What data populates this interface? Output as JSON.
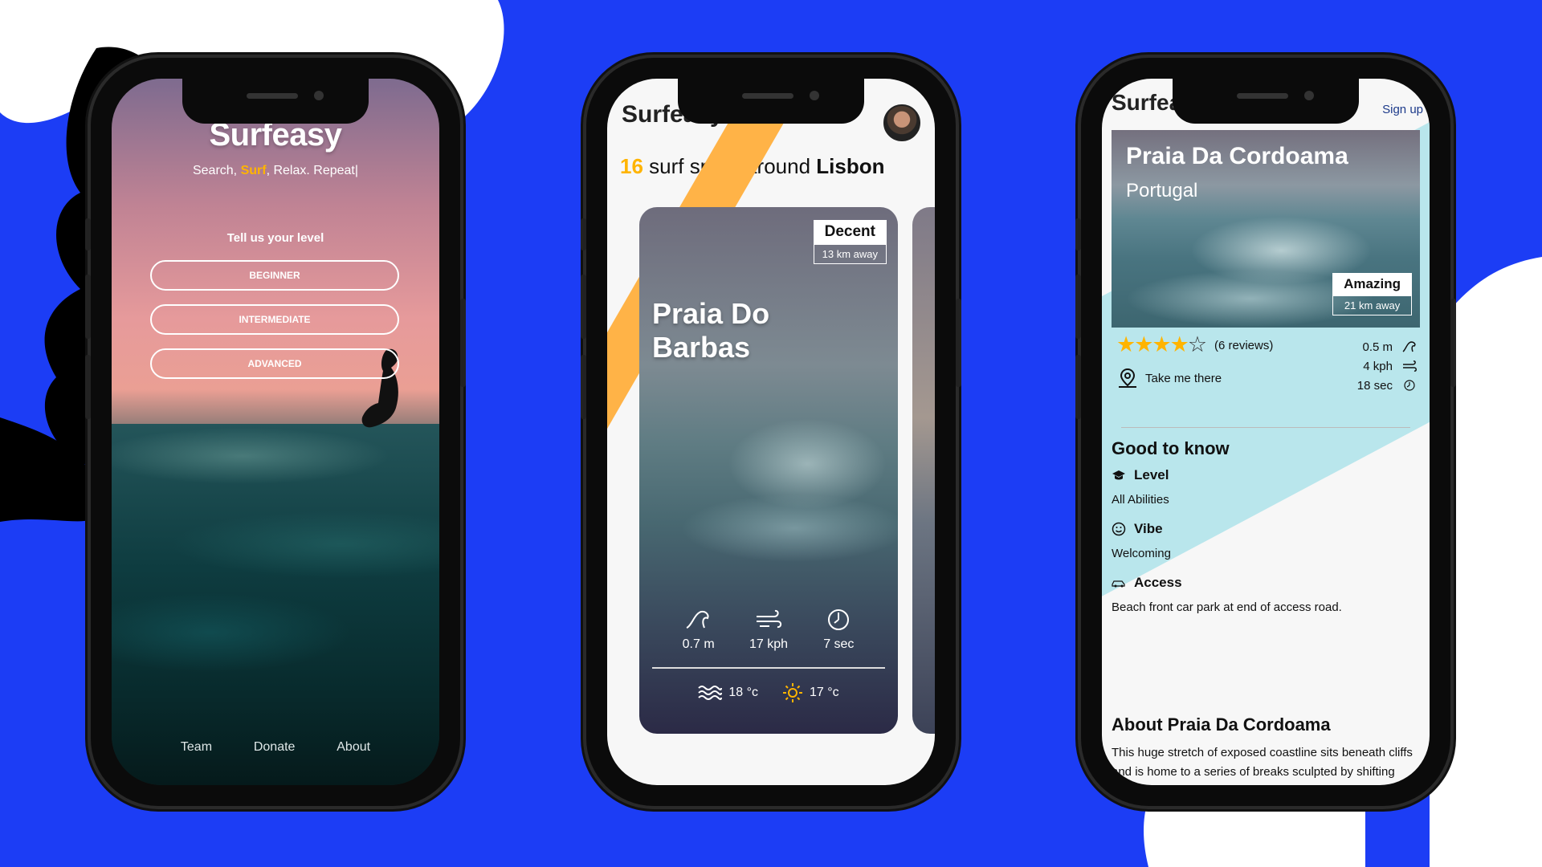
{
  "brand": "Surfeasy",
  "phone1": {
    "title": "Surfeasy",
    "tagline_pre": "Search,",
    "tagline_hl": "Surf",
    "tagline_post": ", Relax. Repeat|",
    "level_prompt": "Tell us your level",
    "levels": [
      "BEGINNER",
      "INTERMEDIATE",
      "ADVANCED"
    ],
    "footer": [
      "Team",
      "Donate",
      "About"
    ]
  },
  "phone2": {
    "title": "Surfeasy",
    "headline_count": "16",
    "headline_mid": "surf spots around",
    "headline_city": "Lisbon",
    "card": {
      "name_line1": "Praia Do",
      "name_line2": "Barbas",
      "quality": "Decent",
      "distance": "13 km away",
      "wave_height": "0.7 m",
      "wind": "17 kph",
      "period": "7 sec",
      "water_temp": "18 °c",
      "air_temp": "17 °c"
    }
  },
  "phone3": {
    "title": "Surfeasy",
    "signup": "Sign up",
    "spot_name": "Praia Da Cordoama",
    "country": "Portugal",
    "quality": "Amazing",
    "distance": "21 km away",
    "rating": 4,
    "rating_max": 5,
    "reviews": "(6 reviews)",
    "take_me": "Take me there",
    "wave_height": "0.5 m",
    "wind": "4 kph",
    "period": "18 sec",
    "good_to_know": "Good to know",
    "level_label": "Level",
    "level_value": "All Abilities",
    "vibe_label": "Vibe",
    "vibe_value": "Welcoming",
    "access_label": "Access",
    "access_value": "Beach front car park at end of access road.",
    "about_title": "About Praia Da Cordoama",
    "about_text": "This huge stretch of exposed coastline sits beneath cliffs and is home to a series of breaks sculpted by shifting sandbanks, sand covered reefs and rocky outcrops. Nearly all are best low to mid - but occasionally work all through the tides. Best in small swells as it can quickly get too big. The breaks here"
  },
  "colors": {
    "background": "#1c3df5",
    "accent": "#ffb400",
    "stripe_orange": "#ffb347",
    "stripe_cyan": "#b9e6ec"
  }
}
